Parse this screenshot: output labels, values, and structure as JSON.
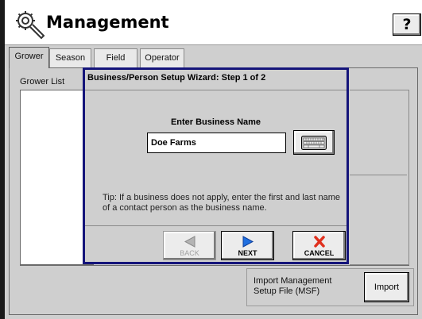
{
  "window": {
    "title": "Management",
    "help_label": "?"
  },
  "tabs": [
    {
      "label": "Grower",
      "active": true
    },
    {
      "label": "Season",
      "active": false
    },
    {
      "label": "Field",
      "active": false
    },
    {
      "label": "Operator",
      "active": false
    }
  ],
  "grower_panel": {
    "list_label": "Grower List"
  },
  "import": {
    "label": "Import Management Setup File (MSF)",
    "button_label": "Import"
  },
  "wizard": {
    "title": "Business/Person Setup Wizard:  Step 1 of 2",
    "prompt": "Enter Business Name",
    "business_name_value": "Doe Farms",
    "tip": "Tip: If a business does not apply, enter the first and last name of a contact person as the business name.",
    "back_label": "BACK",
    "next_label": "NEXT",
    "cancel_label": "CANCEL"
  },
  "colors": {
    "wizard_border": "#14147a",
    "next_arrow": "#1f6fe0",
    "cancel_x": "#e0301e"
  },
  "icons": {
    "title": "wrench-gear-icon",
    "keyboard": "keyboard-icon",
    "back": "back-arrow-icon",
    "next": "next-arrow-icon",
    "cancel": "cancel-x-icon"
  }
}
